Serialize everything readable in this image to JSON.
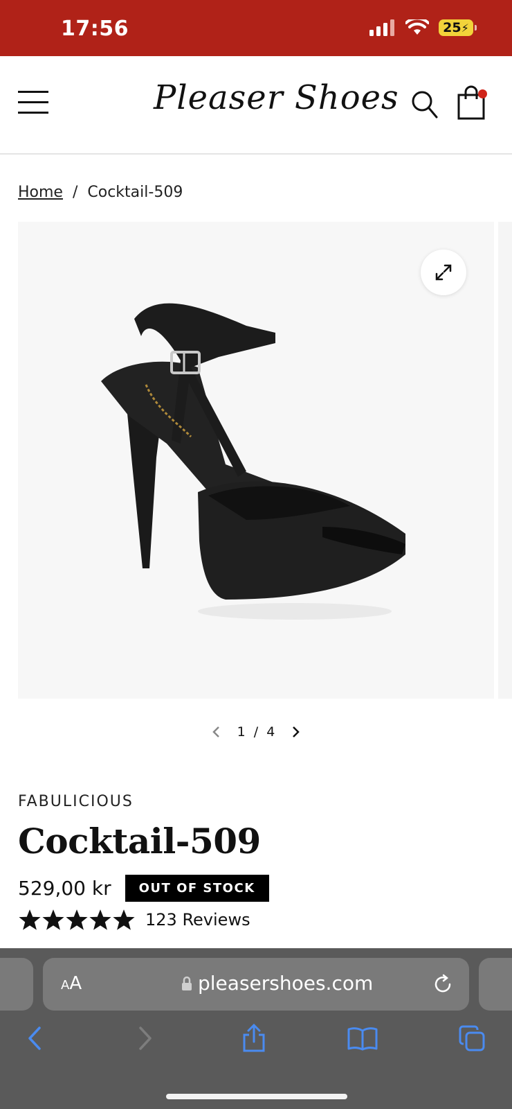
{
  "status_bar": {
    "time": "17:56",
    "battery": "25"
  },
  "header": {
    "logo": "Pleaser Shoes"
  },
  "breadcrumb": {
    "home": "Home",
    "separator": "/",
    "current": "Cocktail-509"
  },
  "gallery": {
    "current": "1",
    "separator": "/",
    "total": "4"
  },
  "product": {
    "brand": "FABULICIOUS",
    "title": "Cocktail-509",
    "price": "529,00 kr",
    "stock_badge": "OUT OF STOCK",
    "rating_stars": 5,
    "reviews": "123 Reviews"
  },
  "browser": {
    "text_size_label_small": "A",
    "text_size_label_large": "A",
    "url": "pleasershoes.com"
  },
  "colors": {
    "status_bar": "#b02218",
    "accent_dot": "#d0241a",
    "browser_icon": "#4a8bf0"
  }
}
